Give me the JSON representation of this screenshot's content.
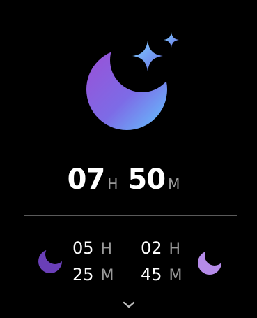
{
  "total": {
    "hours": "07",
    "hours_unit": "H",
    "minutes": "50",
    "minutes_unit": "M"
  },
  "left_phase": {
    "hours": "05",
    "hours_unit": "H",
    "minutes": "25",
    "minutes_unit": "M",
    "icon": "moon-deep-purple-icon"
  },
  "right_phase": {
    "hours": "02",
    "hours_unit": "H",
    "minutes": "45",
    "minutes_unit": "M",
    "icon": "moon-light-purple-icon"
  },
  "colors": {
    "background": "#000000",
    "unit_gray": "#9a9a9a",
    "divider": "#5a5a5a",
    "deep_purple": "#6a3fb8",
    "light_purple": "#b58be8",
    "sparkle_blue": "#7fb0ff"
  },
  "icons": {
    "hero": "crescent-moon-sparkles-icon",
    "expand": "chevron-down-icon"
  }
}
